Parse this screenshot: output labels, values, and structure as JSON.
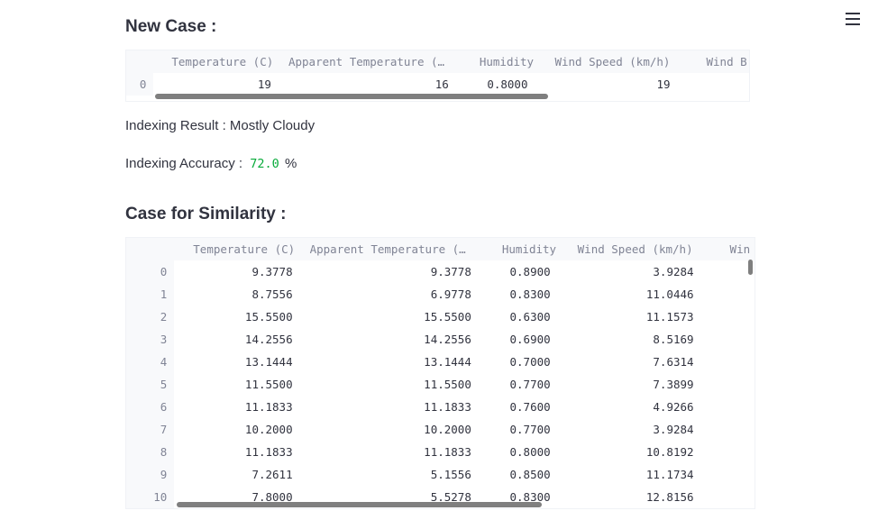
{
  "new_case": {
    "title": "New Case :",
    "columns": [
      "Temperature (C)",
      "Apparent Temperature (…",
      "Humidity",
      "Wind Speed (km/h)",
      "Wind B"
    ],
    "rows": [
      {
        "index": "0",
        "cells": [
          "19",
          "16",
          "0.8000",
          "19",
          ""
        ]
      }
    ]
  },
  "indexing_result": {
    "label": "Indexing Result :",
    "value": "Mostly Cloudy"
  },
  "indexing_accuracy": {
    "label": "Indexing Accuracy :",
    "value": "72.0",
    "unit": "%"
  },
  "similarity": {
    "title": "Case for Similarity :",
    "columns": [
      "Temperature (C)",
      "Apparent Temperature (…",
      "Humidity",
      "Wind Speed (km/h)",
      "Win"
    ],
    "rows": [
      {
        "index": "0",
        "cells": [
          "9.3778",
          "9.3778",
          "0.8900",
          "3.9284",
          ""
        ]
      },
      {
        "index": "1",
        "cells": [
          "8.7556",
          "6.9778",
          "0.8300",
          "11.0446",
          ""
        ]
      },
      {
        "index": "2",
        "cells": [
          "15.5500",
          "15.5500",
          "0.6300",
          "11.1573",
          ""
        ]
      },
      {
        "index": "3",
        "cells": [
          "14.2556",
          "14.2556",
          "0.6900",
          "8.5169",
          ""
        ]
      },
      {
        "index": "4",
        "cells": [
          "13.1444",
          "13.1444",
          "0.7000",
          "7.6314",
          ""
        ]
      },
      {
        "index": "5",
        "cells": [
          "11.5500",
          "11.5500",
          "0.7700",
          "7.3899",
          ""
        ]
      },
      {
        "index": "6",
        "cells": [
          "11.1833",
          "11.1833",
          "0.7600",
          "4.9266",
          ""
        ]
      },
      {
        "index": "7",
        "cells": [
          "10.2000",
          "10.2000",
          "0.7700",
          "3.9284",
          ""
        ]
      },
      {
        "index": "8",
        "cells": [
          "11.1833",
          "11.1833",
          "0.8000",
          "10.8192",
          ""
        ]
      },
      {
        "index": "9",
        "cells": [
          "7.2611",
          "5.1556",
          "0.8500",
          "11.1734",
          ""
        ]
      },
      {
        "index": "10",
        "cells": [
          "7.8000",
          "5.5278",
          "0.8300",
          "12.8156",
          ""
        ]
      }
    ]
  },
  "colors": {
    "accent_green": "#09ab3b",
    "header_bg": "#f8f9fb",
    "muted_text": "#808495"
  },
  "icons": {
    "menu": "hamburger-menu-icon"
  }
}
